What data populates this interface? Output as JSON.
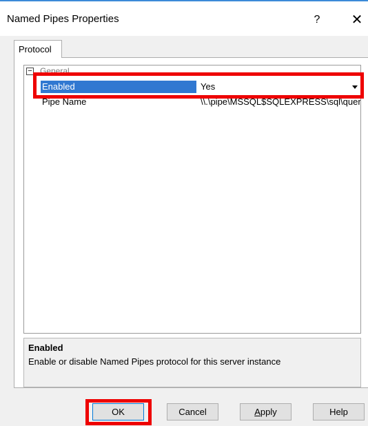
{
  "window": {
    "title": "Named Pipes Properties",
    "help_label": "?",
    "close_label": "✕"
  },
  "tabs": [
    {
      "label": "Protocol",
      "selected": true
    }
  ],
  "grid": {
    "expander_symbol": "−",
    "category_label": "General",
    "rows": [
      {
        "name": "Enabled",
        "value": "Yes",
        "selected": true,
        "has_dropdown": true
      },
      {
        "name": "Pipe Name",
        "value": "\\\\.\\pipe\\MSSQL$SQLEXPRESS\\sql\\query"
      }
    ]
  },
  "description": {
    "title": "Enabled",
    "text": "Enable or disable Named Pipes protocol for this server instance"
  },
  "buttons": {
    "ok": "OK",
    "cancel": "Cancel",
    "apply_accel": "A",
    "apply_rest": "pply",
    "help": "Help"
  },
  "colors": {
    "accent": "#3b8ad8",
    "selection": "#3178d1",
    "highlight_annotation": "#ee0000"
  }
}
